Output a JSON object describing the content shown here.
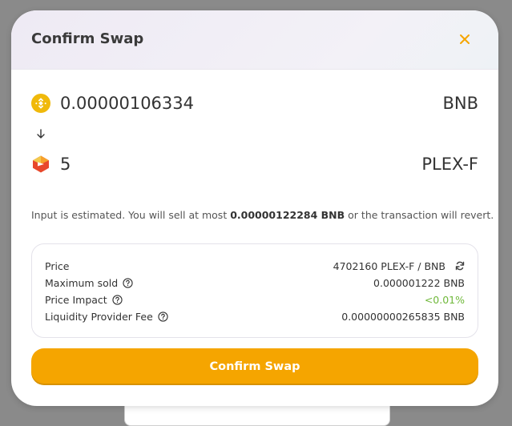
{
  "modal": {
    "title": "Confirm Swap"
  },
  "input_token": {
    "amount": "0.00000106334",
    "symbol": "BNB",
    "icon": "bnb-icon",
    "color": "#f0b90b"
  },
  "output_token": {
    "amount": "5",
    "symbol": "PLEX-F",
    "icon": "plex-icon"
  },
  "note": {
    "prefix": "Input is estimated. You will sell at most ",
    "max_amount": "0.00000122284 BNB",
    "suffix": " or the transaction will revert."
  },
  "details": {
    "price_label": "Price",
    "price_value": "4702160 PLEX-F / BNB",
    "max_sold_label": "Maximum sold",
    "max_sold_value": "0.000001222 BNB",
    "impact_label": "Price Impact",
    "impact_value": "<0.01%",
    "fee_label": "Liquidity Provider Fee",
    "fee_value": "0.00000000265835 BNB"
  },
  "actions": {
    "confirm_label": "Confirm Swap"
  },
  "colors": {
    "accent": "#f5a500",
    "impact": "#6fb83a"
  }
}
